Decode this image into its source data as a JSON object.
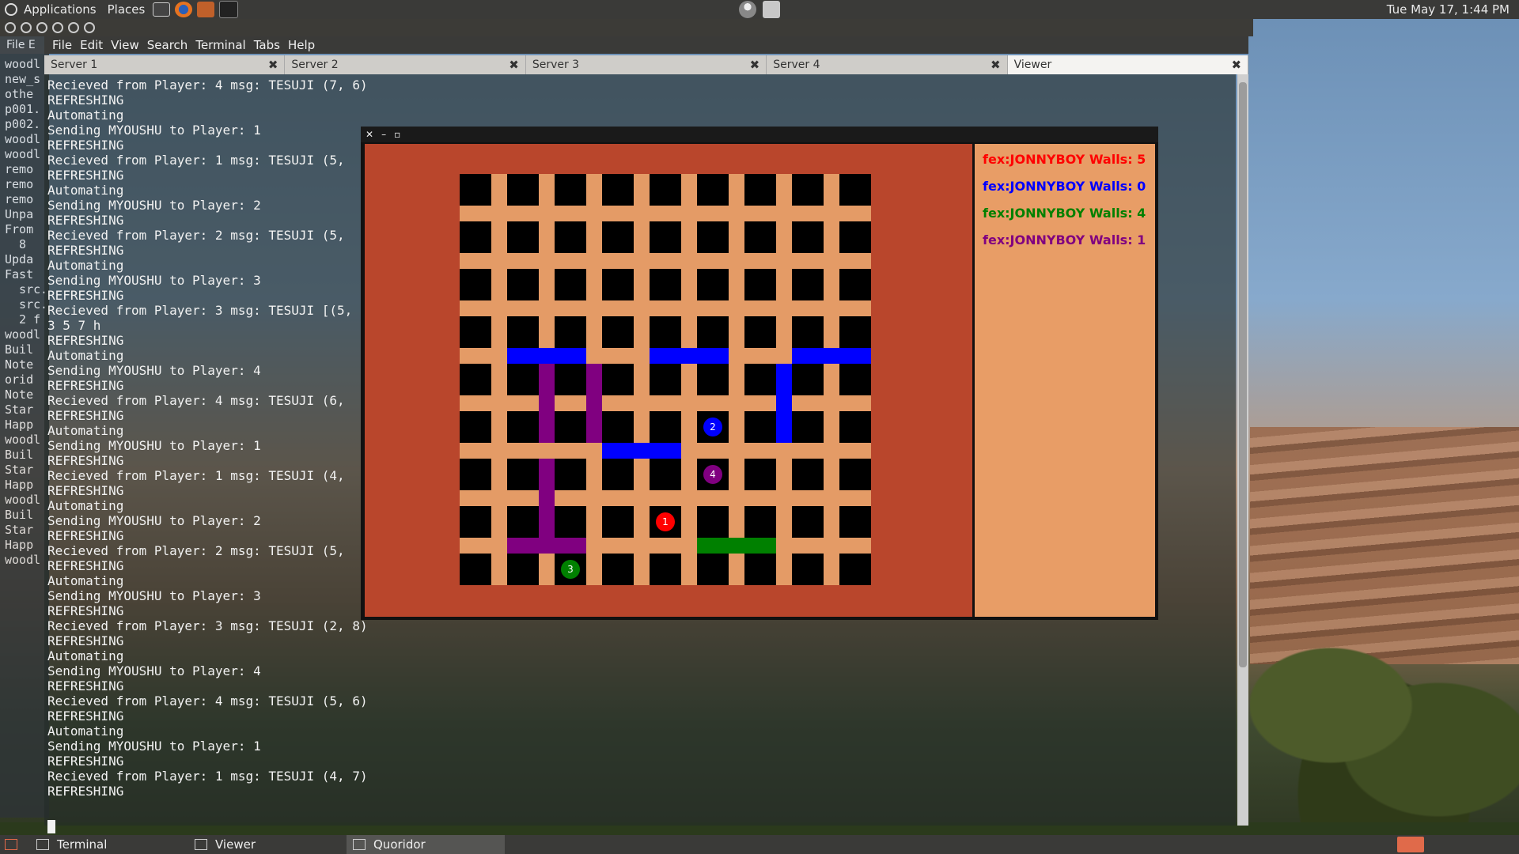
{
  "top_panel": {
    "applications": "Applications",
    "places": "Places",
    "clock": "Tue May 17,  1:44 PM"
  },
  "back_terminal": {
    "menu": "File  E",
    "lines": [
      "woodl",
      "new_s",
      "othe",
      "p001.",
      "p002.",
      "woodl",
      "woodl",
      "remo",
      "remo",
      "remo",
      "Unpa",
      "From",
      "  8",
      "Upda",
      "Fast",
      "  src.",
      "  src.",
      "  2 f",
      "woodl",
      "Buil",
      "Note",
      "orid",
      "Note",
      "Star",
      "Happ",
      "woodl",
      "Buil",
      "Star",
      "Happ",
      "woodl",
      "Buil",
      "Star",
      "Happ",
      "woodl"
    ]
  },
  "terminal": {
    "menu": [
      "File",
      "Edit",
      "View",
      "Search",
      "Terminal",
      "Tabs",
      "Help"
    ],
    "tabs": [
      {
        "label": "Server 1"
      },
      {
        "label": "Server 2"
      },
      {
        "label": "Server 3"
      },
      {
        "label": "Server 4"
      },
      {
        "label": "Viewer"
      }
    ],
    "lines": [
      "Recieved from Player: 4 msg: TESUJI (7, 6)",
      "REFRESHING",
      "Automating",
      "Sending MYOUSHU to Player: 1",
      "REFRESHING",
      "Recieved from Player: 1 msg: TESUJI (5,",
      "REFRESHING",
      "Automating",
      "Sending MYOUSHU to Player: 2",
      "REFRESHING",
      "Recieved from Player: 2 msg: TESUJI (5,",
      "REFRESHING",
      "Automating",
      "Sending MYOUSHU to Player: 3",
      "REFRESHING",
      "Recieved from Player: 3 msg: TESUJI [(5,",
      "3 5 7 h",
      "REFRESHING",
      "Automating",
      "Sending MYOUSHU to Player: 4",
      "REFRESHING",
      "Recieved from Player: 4 msg: TESUJI (6,",
      "REFRESHING",
      "Automating",
      "Sending MYOUSHU to Player: 1",
      "REFRESHING",
      "Recieved from Player: 1 msg: TESUJI (4,",
      "REFRESHING",
      "Automating",
      "Sending MYOUSHU to Player: 2",
      "REFRESHING",
      "Recieved from Player: 2 msg: TESUJI (5,",
      "REFRESHING",
      "Automating",
      "Sending MYOUSHU to Player: 3",
      "REFRESHING",
      "Recieved from Player: 3 msg: TESUJI (2, 8)",
      "REFRESHING",
      "Automating",
      "Sending MYOUSHU to Player: 4",
      "REFRESHING",
      "Recieved from Player: 4 msg: TESUJI (5, 6)",
      "REFRESHING",
      "Automating",
      "Sending MYOUSHU to Player: 1",
      "REFRESHING",
      "Recieved from Player: 1 msg: TESUJI (4, 7)",
      "REFRESHING"
    ]
  },
  "viewer": {
    "board_size": 9,
    "players": [
      {
        "label": "fex:JONNYBOY Walls: 5",
        "color": "#ff0000"
      },
      {
        "label": "fex:JONNYBOY Walls: 0",
        "color": "#0000ff"
      },
      {
        "label": "fex:JONNYBOY Walls: 4",
        "color": "#008000"
      },
      {
        "label": "fex:JONNYBOY Walls: 1",
        "color": "#800080"
      }
    ],
    "pawns": [
      {
        "id": "1",
        "color": "#ff0000",
        "col": 4,
        "row": 7
      },
      {
        "id": "2",
        "color": "#0000ff",
        "col": 5,
        "row": 5
      },
      {
        "id": "3",
        "color": "#008000",
        "col": 2,
        "row": 8
      },
      {
        "id": "4",
        "color": "#800080",
        "col": 5,
        "row": 6
      }
    ],
    "walls": [
      {
        "color": "#0000ff",
        "orient": "h",
        "col": 1,
        "row": 4
      },
      {
        "color": "#0000ff",
        "orient": "h",
        "col": 4,
        "row": 4
      },
      {
        "color": "#0000ff",
        "orient": "h",
        "col": 7,
        "row": 4
      },
      {
        "color": "#0000ff",
        "orient": "v",
        "col": 7,
        "row": 4
      },
      {
        "color": "#0000ff",
        "orient": "h",
        "col": 3,
        "row": 6
      },
      {
        "color": "#800080",
        "orient": "v",
        "col": 2,
        "row": 4
      },
      {
        "color": "#800080",
        "orient": "v",
        "col": 3,
        "row": 4
      },
      {
        "color": "#800080",
        "orient": "v",
        "col": 2,
        "row": 6
      },
      {
        "color": "#800080",
        "orient": "h",
        "col": 1,
        "row": 8
      },
      {
        "color": "#008000",
        "orient": "h",
        "col": 5,
        "row": 8
      }
    ]
  },
  "taskbar": {
    "items": [
      {
        "label": "Terminal"
      },
      {
        "label": "Viewer"
      },
      {
        "label": "Quoridor"
      }
    ]
  }
}
